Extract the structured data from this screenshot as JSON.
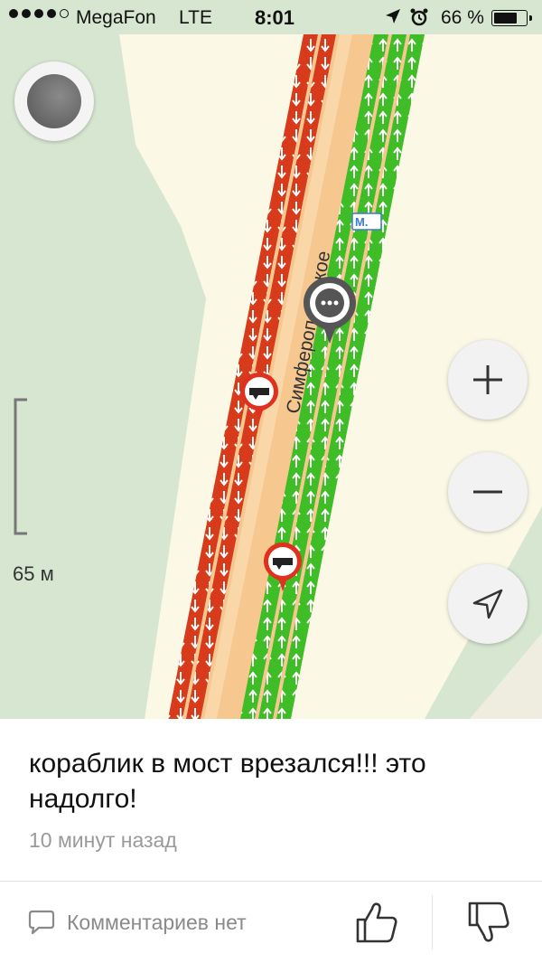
{
  "status_bar": {
    "carrier": "MegaFon",
    "network": "LTE",
    "time": "8:01",
    "battery_percent": "66 %",
    "battery_level": 0.66,
    "signal_bars": 4,
    "icons": [
      "location-arrow-icon",
      "alarm-icon",
      "battery-icon"
    ]
  },
  "map": {
    "road_name": "Симферопольское",
    "metro_badge": "М.",
    "scale_label": "65 м",
    "colors": {
      "jam": "#d83b1b",
      "free": "#3ebd26",
      "road": "#f6c88f",
      "land": "#fbf9e6",
      "park": "#d6e6d0"
    }
  },
  "controls": {
    "zoom_in": "+",
    "zoom_out": "−",
    "icons": [
      "avatar",
      "plus-icon",
      "minus-icon",
      "navigation-arrow-icon",
      "chat-pin-icon",
      "accident-pin-icon"
    ]
  },
  "report": {
    "message": "кораблик в мост врезался!!! это надолго!",
    "time_ago": "10 минут назад",
    "comments_label": "Комментариев нет"
  }
}
